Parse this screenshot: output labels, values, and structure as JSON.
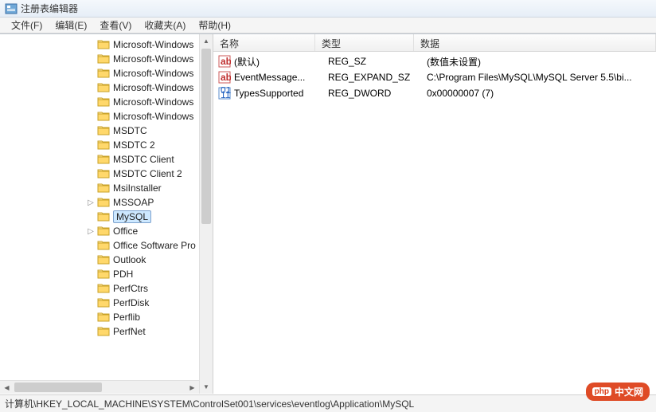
{
  "window": {
    "title": "注册表编辑器"
  },
  "menu": {
    "file": "文件(F)",
    "edit": "编辑(E)",
    "view": "查看(V)",
    "favorites": "收藏夹(A)",
    "help": "帮助(H)"
  },
  "tree": {
    "items": [
      {
        "label": "Microsoft-Windows",
        "expander": ""
      },
      {
        "label": "Microsoft-Windows",
        "expander": ""
      },
      {
        "label": "Microsoft-Windows",
        "expander": ""
      },
      {
        "label": "Microsoft-Windows",
        "expander": ""
      },
      {
        "label": "Microsoft-Windows",
        "expander": ""
      },
      {
        "label": "Microsoft-Windows",
        "expander": ""
      },
      {
        "label": "MSDTC",
        "expander": ""
      },
      {
        "label": "MSDTC 2",
        "expander": ""
      },
      {
        "label": "MSDTC Client",
        "expander": ""
      },
      {
        "label": "MSDTC Client 2",
        "expander": ""
      },
      {
        "label": "MsiInstaller",
        "expander": ""
      },
      {
        "label": "MSSOAP",
        "expander": "▷"
      },
      {
        "label": "MySQL",
        "expander": "",
        "selected": true
      },
      {
        "label": "Office",
        "expander": "▷"
      },
      {
        "label": "Office Software Pro",
        "expander": ""
      },
      {
        "label": "Outlook",
        "expander": ""
      },
      {
        "label": "PDH",
        "expander": ""
      },
      {
        "label": "PerfCtrs",
        "expander": ""
      },
      {
        "label": "PerfDisk",
        "expander": ""
      },
      {
        "label": "Perflib",
        "expander": ""
      },
      {
        "label": "PerfNet",
        "expander": ""
      }
    ]
  },
  "list": {
    "headers": {
      "name": "名称",
      "type": "类型",
      "data": "数据"
    },
    "rows": [
      {
        "icon": "string",
        "name": "(默认)",
        "type": "REG_SZ",
        "data": "(数值未设置)"
      },
      {
        "icon": "string",
        "name": "EventMessage...",
        "type": "REG_EXPAND_SZ",
        "data": "C:\\Program Files\\MySQL\\MySQL Server 5.5\\bi..."
      },
      {
        "icon": "binary",
        "name": "TypesSupported",
        "type": "REG_DWORD",
        "data": "0x00000007 (7)"
      }
    ]
  },
  "statusbar": {
    "path": "计算机\\HKEY_LOCAL_MACHINE\\SYSTEM\\ControlSet001\\services\\eventlog\\Application\\MySQL"
  },
  "watermark": {
    "badge": "php",
    "text": "中文网"
  }
}
